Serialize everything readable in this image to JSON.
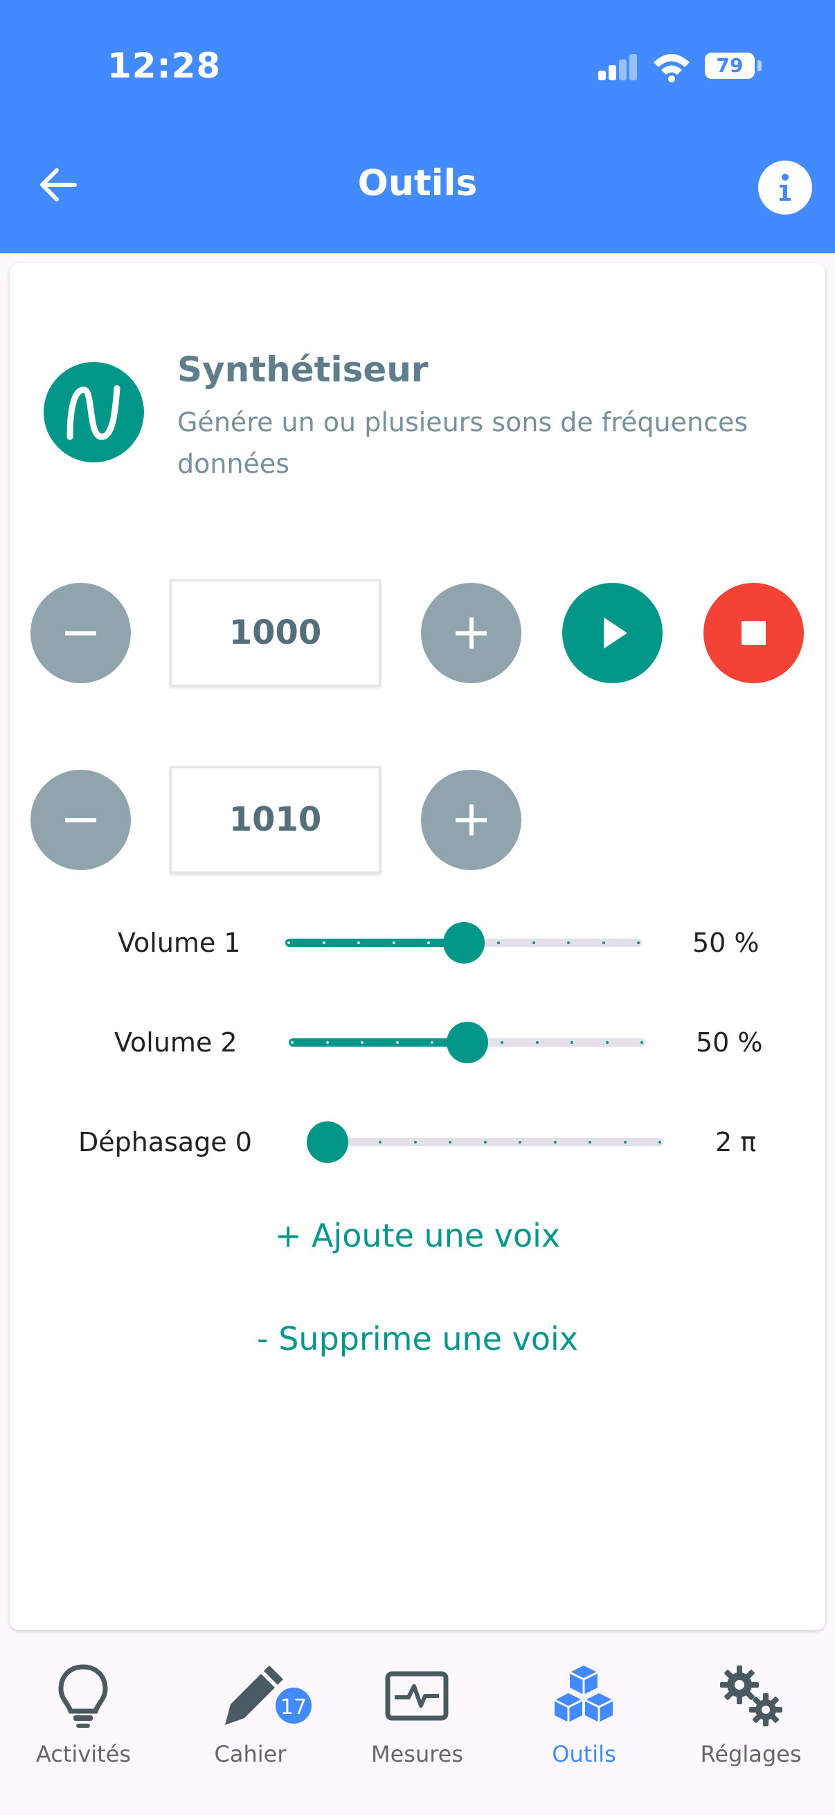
{
  "status_bar": {
    "time": "12:28",
    "battery": "79"
  },
  "header": {
    "title": "Outils"
  },
  "tool": {
    "title": "Synthétiseur",
    "description": "Génére un ou plusieurs sons de fréquences données"
  },
  "voices": [
    {
      "frequency": "1000"
    },
    {
      "frequency": "1010"
    }
  ],
  "sliders": [
    {
      "label": "Volume 1",
      "value_text": "50 %",
      "value": 0.5
    },
    {
      "label": "Volume 2",
      "value_text": "50 %",
      "value": 0.5
    },
    {
      "label": "Déphasage 0",
      "value_text": "2 π",
      "value": 0.0
    }
  ],
  "actions": {
    "add_voice": "+ Ajoute une voix",
    "remove_voice": "- Supprime une voix"
  },
  "nav": {
    "items": [
      {
        "label": "Activités",
        "icon": "lightbulb-icon"
      },
      {
        "label": "Cahier",
        "icon": "pencil-icon",
        "badge": "17"
      },
      {
        "label": "Mesures",
        "icon": "pulse-monitor-icon"
      },
      {
        "label": "Outils",
        "icon": "cubes-icon",
        "active": true
      },
      {
        "label": "Réglages",
        "icon": "gears-icon"
      }
    ]
  },
  "colors": {
    "primary": "#448aff",
    "accent": "#009688",
    "stop": "#f44336",
    "neutral_button": "#90a4ae"
  }
}
